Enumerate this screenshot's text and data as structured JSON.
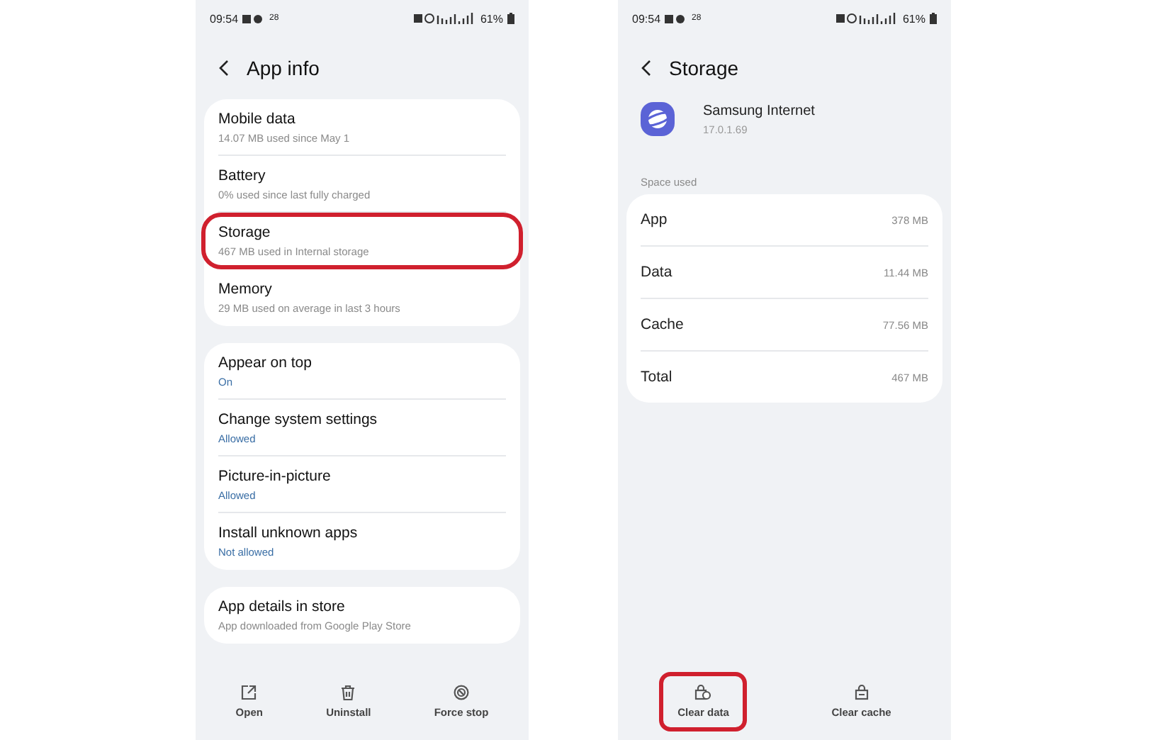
{
  "app_info_screen": {
    "status_bar": {
      "time": "09:54",
      "notification_count": "28",
      "battery": "61%"
    },
    "title": "App info",
    "groups": [
      {
        "items": [
          {
            "title": "Mobile data",
            "subtitle": "14.07 MB used since May 1",
            "accent": false,
            "highlighted": false
          },
          {
            "title": "Battery",
            "subtitle": "0% used since last fully charged",
            "accent": false,
            "highlighted": false
          },
          {
            "title": "Storage",
            "subtitle": "467 MB used in Internal storage",
            "accent": false,
            "highlighted": true
          },
          {
            "title": "Memory",
            "subtitle": "29 MB used on average in last 3 hours",
            "accent": false,
            "highlighted": false
          }
        ]
      },
      {
        "items": [
          {
            "title": "Appear on top",
            "subtitle": "On",
            "accent": true,
            "highlighted": false
          },
          {
            "title": "Change system settings",
            "subtitle": "Allowed",
            "accent": true,
            "highlighted": false
          },
          {
            "title": "Picture-in-picture",
            "subtitle": "Allowed",
            "accent": true,
            "highlighted": false
          },
          {
            "title": "Install unknown apps",
            "subtitle": "Not allowed",
            "accent": true,
            "highlighted": false
          }
        ]
      },
      {
        "items": [
          {
            "title": "App details in store",
            "subtitle": "App downloaded from Google Play Store",
            "accent": false,
            "highlighted": false
          }
        ]
      }
    ],
    "actions": [
      {
        "label": "Open",
        "kind": "open",
        "highlighted": false
      },
      {
        "label": "Uninstall",
        "kind": "uninstall",
        "highlighted": false
      },
      {
        "label": "Force stop",
        "kind": "force_stop",
        "highlighted": false
      }
    ]
  },
  "storage_screen": {
    "status_bar": {
      "time": "09:54",
      "notification_count": "28",
      "battery": "61%"
    },
    "title": "Storage",
    "app": {
      "name": "Samsung Internet",
      "version": "17.0.1.69"
    },
    "section_label": "Space used",
    "rows": [
      {
        "label": "App",
        "value": "378 MB"
      },
      {
        "label": "Data",
        "value": "11.44 MB"
      },
      {
        "label": "Cache",
        "value": "77.56 MB"
      },
      {
        "label": "Total",
        "value": "467 MB"
      }
    ],
    "actions": [
      {
        "label": "Clear data",
        "kind": "clear_data",
        "highlighted": true
      },
      {
        "label": "Clear cache",
        "kind": "clear_cache",
        "highlighted": false
      }
    ]
  }
}
